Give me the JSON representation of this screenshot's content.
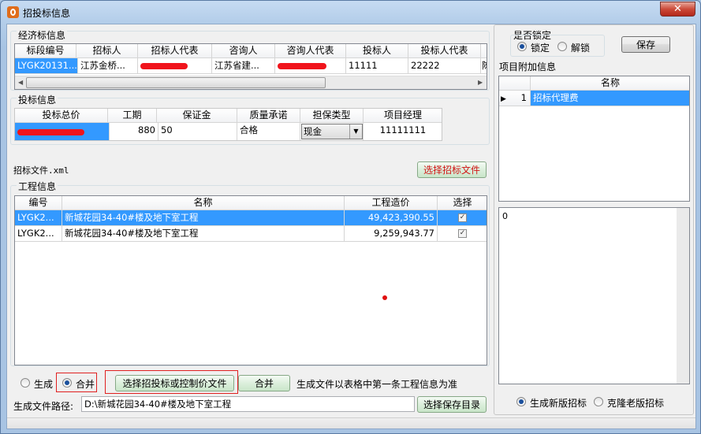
{
  "window": {
    "title": "招投标信息",
    "close_label": "✕"
  },
  "econ": {
    "title": "经济标信息",
    "columns": [
      "标段编号",
      "招标人",
      "招标人代表",
      "咨询人",
      "咨询人代表",
      "投标人",
      "投标人代表"
    ],
    "row": [
      "LYGK20131...",
      "江苏金桥...",
      "",
      "江苏省建...",
      "",
      "11111",
      "22222"
    ],
    "trailing": "陈"
  },
  "bid": {
    "title": "投标信息",
    "columns": [
      "投标总价",
      "工期",
      "保证金",
      "质量承诺",
      "担保类型",
      "项目经理"
    ],
    "row": [
      "",
      "880",
      "50",
      "合格",
      "现金",
      "11111111"
    ]
  },
  "file": {
    "label": "招标文件.xml",
    "button": "选择招标文件"
  },
  "project": {
    "title": "工程信息",
    "columns": [
      "编号",
      "名称",
      "工程造价",
      "选择"
    ],
    "rows": [
      {
        "code": "LYGK2...",
        "name": "新城花园34-40#楼及地下室工程",
        "cost": "49,423,390.55",
        "check": "✓"
      },
      {
        "code": "LYGK2...",
        "name": "新城花园34-40#楼及地下室工程",
        "cost": "9,259,943.77",
        "check": "✓"
      }
    ]
  },
  "bottom": {
    "generate": "生成",
    "merge_radio": "合并",
    "select_btn": "选择招投标或控制价文件",
    "merge_btn": "合并",
    "note": "生成文件以表格中第一条工程信息为准",
    "path_label": "生成文件路径:",
    "path_value": "D:\\新城花园34-40#楼及地下室工程",
    "save_dir_btn": "选择保存目录"
  },
  "lock": {
    "title": "是否锁定",
    "locked": "锁定",
    "unlocked": "解锁",
    "save": "保存"
  },
  "extra": {
    "title": "项目附加信息",
    "column": "名称",
    "row_num": "1",
    "row_name": "招标代理费",
    "memo": "0"
  },
  "mode": {
    "new": "生成新版招标",
    "clone": "克隆老版招标"
  },
  "colors": {
    "selection": "#3399ff",
    "redaction": "#f0141c",
    "highlight_box": "#e02020"
  }
}
